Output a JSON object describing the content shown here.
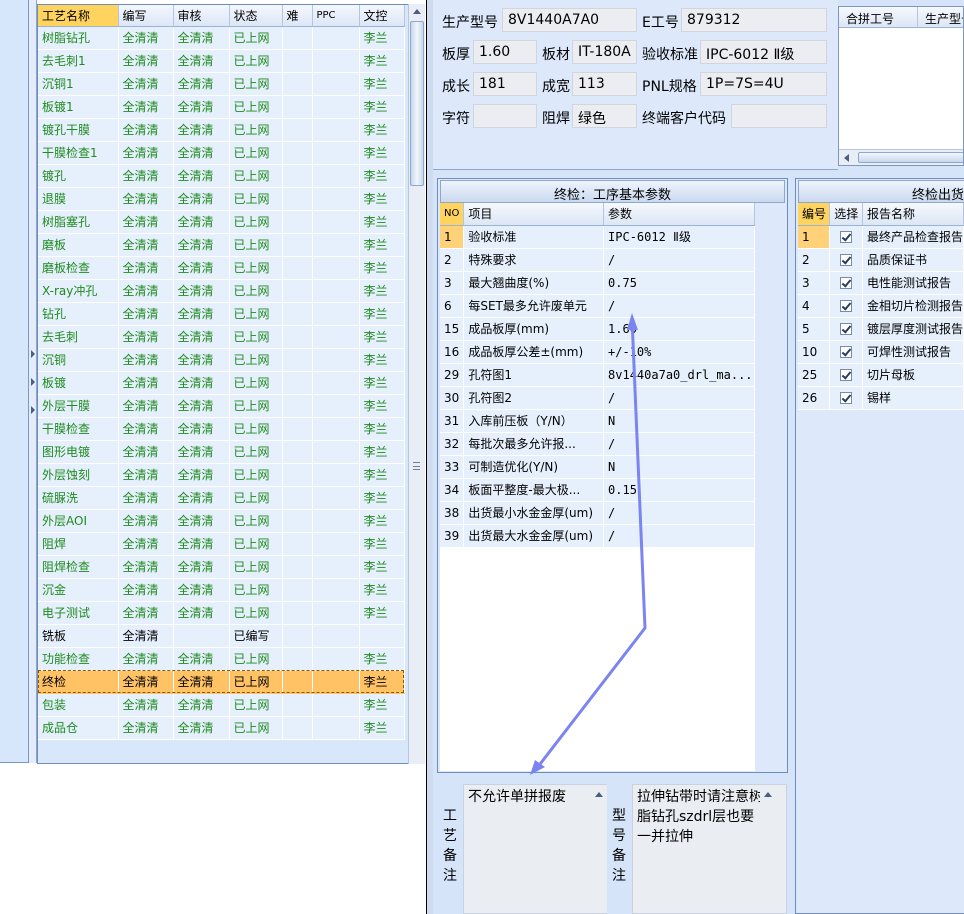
{
  "process_grid": {
    "columns": [
      "工艺名称",
      "编写",
      "审核",
      "状态",
      "难",
      "PPC",
      "文控"
    ],
    "rows": [
      {
        "name": "树脂钻孔",
        "editor": "全清清",
        "reviewer": "全清清",
        "status": "已上网",
        "difficulty": "",
        "ppc": "",
        "doc_ctrl": "李兰"
      },
      {
        "name": "去毛刺1",
        "editor": "全清清",
        "reviewer": "全清清",
        "status": "已上网",
        "difficulty": "",
        "ppc": "",
        "doc_ctrl": "李兰"
      },
      {
        "name": "沉铜1",
        "editor": "全清清",
        "reviewer": "全清清",
        "status": "已上网",
        "difficulty": "",
        "ppc": "",
        "doc_ctrl": "李兰"
      },
      {
        "name": "板镀1",
        "editor": "全清清",
        "reviewer": "全清清",
        "status": "已上网",
        "difficulty": "",
        "ppc": "",
        "doc_ctrl": "李兰"
      },
      {
        "name": "镀孔干膜",
        "editor": "全清清",
        "reviewer": "全清清",
        "status": "已上网",
        "difficulty": "",
        "ppc": "",
        "doc_ctrl": "李兰"
      },
      {
        "name": "干膜检查1",
        "editor": "全清清",
        "reviewer": "全清清",
        "status": "已上网",
        "difficulty": "",
        "ppc": "",
        "doc_ctrl": "李兰"
      },
      {
        "name": "镀孔",
        "editor": "全清清",
        "reviewer": "全清清",
        "status": "已上网",
        "difficulty": "",
        "ppc": "",
        "doc_ctrl": "李兰"
      },
      {
        "name": "退膜",
        "editor": "全清清",
        "reviewer": "全清清",
        "status": "已上网",
        "difficulty": "",
        "ppc": "",
        "doc_ctrl": "李兰"
      },
      {
        "name": "树脂塞孔",
        "editor": "全清清",
        "reviewer": "全清清",
        "status": "已上网",
        "difficulty": "",
        "ppc": "",
        "doc_ctrl": "李兰"
      },
      {
        "name": "磨板",
        "editor": "全清清",
        "reviewer": "全清清",
        "status": "已上网",
        "difficulty": "",
        "ppc": "",
        "doc_ctrl": "李兰"
      },
      {
        "name": "磨板检查",
        "editor": "全清清",
        "reviewer": "全清清",
        "status": "已上网",
        "difficulty": "",
        "ppc": "",
        "doc_ctrl": "李兰"
      },
      {
        "name": "X-ray冲孔",
        "editor": "全清清",
        "reviewer": "全清清",
        "status": "已上网",
        "difficulty": "",
        "ppc": "",
        "doc_ctrl": "李兰"
      },
      {
        "name": "钻孔",
        "editor": "全清清",
        "reviewer": "全清清",
        "status": "已上网",
        "difficulty": "",
        "ppc": "",
        "doc_ctrl": "李兰"
      },
      {
        "name": "去毛刺",
        "editor": "全清清",
        "reviewer": "全清清",
        "status": "已上网",
        "difficulty": "",
        "ppc": "",
        "doc_ctrl": "李兰"
      },
      {
        "name": "沉铜",
        "editor": "全清清",
        "reviewer": "全清清",
        "status": "已上网",
        "difficulty": "",
        "ppc": "",
        "doc_ctrl": "李兰"
      },
      {
        "name": "板镀",
        "editor": "全清清",
        "reviewer": "全清清",
        "status": "已上网",
        "difficulty": "",
        "ppc": "",
        "doc_ctrl": "李兰"
      },
      {
        "name": "外层干膜",
        "editor": "全清清",
        "reviewer": "全清清",
        "status": "已上网",
        "difficulty": "",
        "ppc": "",
        "doc_ctrl": "李兰"
      },
      {
        "name": "干膜检查",
        "editor": "全清清",
        "reviewer": "全清清",
        "status": "已上网",
        "difficulty": "",
        "ppc": "",
        "doc_ctrl": "李兰"
      },
      {
        "name": "图形电镀",
        "editor": "全清清",
        "reviewer": "全清清",
        "status": "已上网",
        "difficulty": "",
        "ppc": "",
        "doc_ctrl": "李兰"
      },
      {
        "name": "外层蚀刻",
        "editor": "全清清",
        "reviewer": "全清清",
        "status": "已上网",
        "difficulty": "",
        "ppc": "",
        "doc_ctrl": "李兰"
      },
      {
        "name": "硫脲洗",
        "editor": "全清清",
        "reviewer": "全清清",
        "status": "已上网",
        "difficulty": "",
        "ppc": "",
        "doc_ctrl": "李兰"
      },
      {
        "name": "外层AOI",
        "editor": "全清清",
        "reviewer": "全清清",
        "status": "已上网",
        "difficulty": "",
        "ppc": "",
        "doc_ctrl": "李兰"
      },
      {
        "name": "阻焊",
        "editor": "全清清",
        "reviewer": "全清清",
        "status": "已上网",
        "difficulty": "",
        "ppc": "",
        "doc_ctrl": "李兰"
      },
      {
        "name": "阻焊检查",
        "editor": "全清清",
        "reviewer": "全清清",
        "status": "已上网",
        "difficulty": "",
        "ppc": "",
        "doc_ctrl": "李兰"
      },
      {
        "name": "沉金",
        "editor": "全清清",
        "reviewer": "全清清",
        "status": "已上网",
        "difficulty": "",
        "ppc": "",
        "doc_ctrl": "李兰"
      },
      {
        "name": "电子测试",
        "editor": "全清清",
        "reviewer": "全清清",
        "status": "已上网",
        "difficulty": "",
        "ppc": "",
        "doc_ctrl": "李兰"
      },
      {
        "name": "铣板",
        "editor": "全清清",
        "reviewer": "",
        "status": "已编写",
        "difficulty": "",
        "ppc": "",
        "doc_ctrl": "",
        "pending": true
      },
      {
        "name": "功能检查",
        "editor": "全清清",
        "reviewer": "全清清",
        "status": "已上网",
        "difficulty": "",
        "ppc": "",
        "doc_ctrl": "李兰"
      },
      {
        "name": "终检",
        "editor": "全清清",
        "reviewer": "全清清",
        "status": "已上网",
        "difficulty": "",
        "ppc": "",
        "doc_ctrl": "李兰",
        "selected": true
      },
      {
        "name": "包装",
        "editor": "全清清",
        "reviewer": "全清清",
        "status": "已上网",
        "difficulty": "",
        "ppc": "",
        "doc_ctrl": "李兰"
      },
      {
        "name": "成品仓",
        "editor": "全清清",
        "reviewer": "全清清",
        "status": "已上网",
        "difficulty": "",
        "ppc": "",
        "doc_ctrl": "李兰"
      }
    ]
  },
  "info": {
    "model_label": "生产型号",
    "model_value": "8V1440A7A0",
    "eno_label": "E工号",
    "eno_value": "879312",
    "thickness_label": "板厚",
    "thickness_value": "1.60",
    "material_label": "板材",
    "material_value": "IT-180A",
    "standard_label": "验收标准",
    "standard_value": "IPC-6012 Ⅱ级",
    "length_label": "成长",
    "length_value": "181",
    "width_label": "成宽",
    "width_value": "113",
    "pnl_label": "PNL规格",
    "pnl_value": "1P=7S=4U",
    "char_label": "字符",
    "char_value": "",
    "mask_label": "阻焊",
    "mask_value": "绿色",
    "customer_label": "终端客户代码",
    "customer_value": ""
  },
  "merge_grid": {
    "columns": [
      "合拼工号",
      "生产型号"
    ]
  },
  "params": {
    "title": "终检：工序基本参数",
    "columns": [
      "NO",
      "项目",
      "参数"
    ],
    "rows": [
      {
        "no": "1",
        "item": "验收标准",
        "value": "IPC-6012 Ⅱ级",
        "selected": true
      },
      {
        "no": "2",
        "item": "特殊要求",
        "value": "/"
      },
      {
        "no": "3",
        "item": "最大翘曲度(%)",
        "value": "0.75"
      },
      {
        "no": "6",
        "item": "每SET最多允许废单元",
        "value": "/"
      },
      {
        "no": "15",
        "item": "成品板厚(mm)",
        "value": "1.60"
      },
      {
        "no": "16",
        "item": "成品板厚公差±(mm)",
        "value": "+/-10%"
      },
      {
        "no": "29",
        "item": "孔符图1",
        "value": "8v1440a7a0_drl_ma..."
      },
      {
        "no": "30",
        "item": "孔符图2",
        "value": "/"
      },
      {
        "no": "31",
        "item": "入库前压板（Y/N）",
        "value": "N"
      },
      {
        "no": "32",
        "item": "每批次最多允许报...",
        "value": "/"
      },
      {
        "no": "33",
        "item": "可制造优化(Y/N)",
        "value": "N"
      },
      {
        "no": "34",
        "item": "板面平整度-最大极...",
        "value": "0.15"
      },
      {
        "no": "38",
        "item": "出货最小水金金厚(um)",
        "value": "/"
      },
      {
        "no": "39",
        "item": "出货最大水金金厚(um)",
        "value": "/"
      }
    ]
  },
  "reports": {
    "title": "终检出货报告",
    "columns": [
      "编号",
      "选择",
      "报告名称"
    ],
    "rows": [
      {
        "no": "1",
        "checked": true,
        "name": "最终产品检查报告",
        "selected": true
      },
      {
        "no": "2",
        "checked": true,
        "name": "品质保证书"
      },
      {
        "no": "3",
        "checked": true,
        "name": "电性能测试报告"
      },
      {
        "no": "4",
        "checked": true,
        "name": "金相切片检测报告"
      },
      {
        "no": "5",
        "checked": true,
        "name": "镀层厚度测试报告"
      },
      {
        "no": "10",
        "checked": true,
        "name": "可焊性测试报告"
      },
      {
        "no": "25",
        "checked": true,
        "name": "切片母板"
      },
      {
        "no": "26",
        "checked": true,
        "name": "锡样"
      }
    ]
  },
  "notes": {
    "process_label": "工艺备注",
    "process_text": "不允许单拼报废",
    "model_label": "型号备注",
    "model_text": "拉伸钻带时请注意树脂钻孔szdrl层也要一并拉伸"
  },
  "colors": {
    "online_text": "#1f8a1f",
    "selected_row": "#ffc265",
    "header_highlight": "#ffd45e",
    "annotation_arrow": "#7b84f0"
  }
}
